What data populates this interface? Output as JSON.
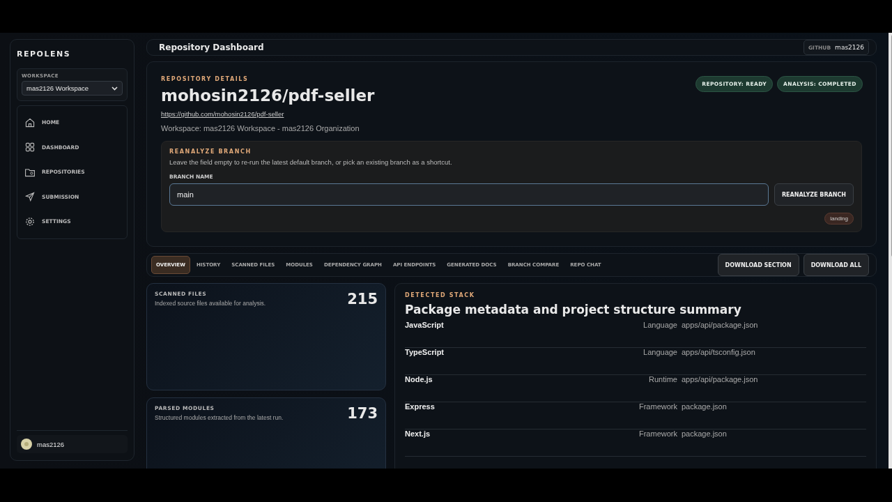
{
  "sidebar": {
    "brand": "REPOLENS",
    "workspace_label": "WORKSPACE",
    "workspace_value": "mas2126 Workspace",
    "items": [
      {
        "label": "HOME"
      },
      {
        "label": "DASHBOARD"
      },
      {
        "label": "REPOSITORIES"
      },
      {
        "label": "SUBMISSION"
      },
      {
        "label": "SETTINGS"
      }
    ],
    "user": "mas2126"
  },
  "header": {
    "title": "Repository Dashboard",
    "account_label": "GITHUB",
    "account": "mas2126"
  },
  "repo": {
    "eyebrow": "REPOSITORY DETAILS",
    "name": "mohosin2126/pdf-seller",
    "url": "https://github.com/mohosin2126/pdf-seller",
    "workspace": "Workspace: mas2126 Workspace - mas2126 Organization",
    "statuses": [
      "REPOSITORY: READY",
      "ANALYSIS: COMPLETED"
    ]
  },
  "reanalyze": {
    "title": "REANALYZE BRANCH",
    "hint": "Leave the field empty to re-run the latest default branch, or pick an existing branch as a shortcut.",
    "field_label": "BRANCH NAME",
    "value": "main",
    "button": "REANALYZE BRANCH",
    "branches": [
      "landing"
    ]
  },
  "tabs": [
    {
      "label": "OVERVIEW",
      "selected": true
    },
    {
      "label": "HISTORY",
      "selected": false
    },
    {
      "label": "SCANNED FILES",
      "selected": false
    },
    {
      "label": "MODULES",
      "selected": false
    },
    {
      "label": "DEPENDENCY GRAPH",
      "selected": false
    },
    {
      "label": "API ENDPOINTS",
      "selected": false
    },
    {
      "label": "GENERATED DOCS",
      "selected": false
    },
    {
      "label": "BRANCH COMPARE",
      "selected": false
    },
    {
      "label": "REPO CHAT",
      "selected": false
    }
  ],
  "actions": [
    "DOWNLOAD SECTION",
    "DOWNLOAD ALL"
  ],
  "stats": [
    {
      "title": "SCANNED FILES",
      "description": "Indexed source files available for analysis.",
      "value": "215"
    },
    {
      "title": "PARSED MODULES",
      "description": "Structured modules extracted from the latest run.",
      "value": "173"
    }
  ],
  "stack": {
    "eyebrow": "DETECTED STACK",
    "title": "Package metadata and project structure summary",
    "rows": [
      {
        "name": "JavaScript",
        "type": "Language",
        "path": "apps/api/package.json"
      },
      {
        "name": "TypeScript",
        "type": "Language",
        "path": "apps/api/tsconfig.json"
      },
      {
        "name": "Node.js",
        "type": "Runtime",
        "path": "apps/api/package.json"
      },
      {
        "name": "Express",
        "type": "Framework",
        "path": "package.json"
      },
      {
        "name": "Next.js",
        "type": "Framework",
        "path": "package.json"
      }
    ]
  }
}
